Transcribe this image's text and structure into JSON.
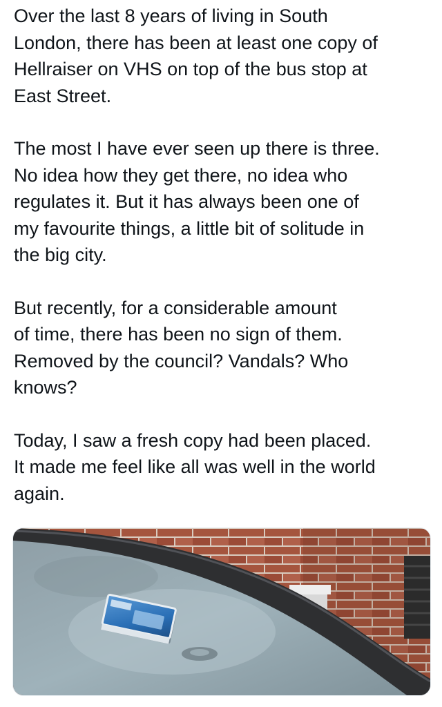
{
  "tweet": {
    "paragraphs": [
      {
        "lines": [
          "Over the last 8 years of living in South",
          "London, there has been at least one copy of",
          "Hellraiser on VHS on top of the bus stop at",
          "East Street."
        ]
      },
      {
        "lines": [
          "The most I have ever seen up there is three.",
          "No idea how they get there, no idea who",
          "regulates it. But it has always been one of",
          "my favourite things, a little bit of solitude in",
          "the big city."
        ]
      },
      {
        "lines": [
          "But recently, for a considerable amount",
          "of time, there has been no sign of them.",
          "Removed by the council? Vandals? Who",
          "knows?"
        ]
      },
      {
        "lines": [
          "Today, I saw a fresh copy had been placed.",
          "It made me feel like all was well in the world",
          "again."
        ]
      }
    ]
  },
  "media": {
    "alt": "Photo of a VHS tape lying on top of a bus shelter roof in front of a brick wall",
    "colors": {
      "brick": "#a5553e",
      "mortar": "#d9cbbf",
      "roof": "#8fa2ab",
      "roof_edge": "#2e2f31",
      "tape_blue": "#2a6fb6"
    }
  }
}
